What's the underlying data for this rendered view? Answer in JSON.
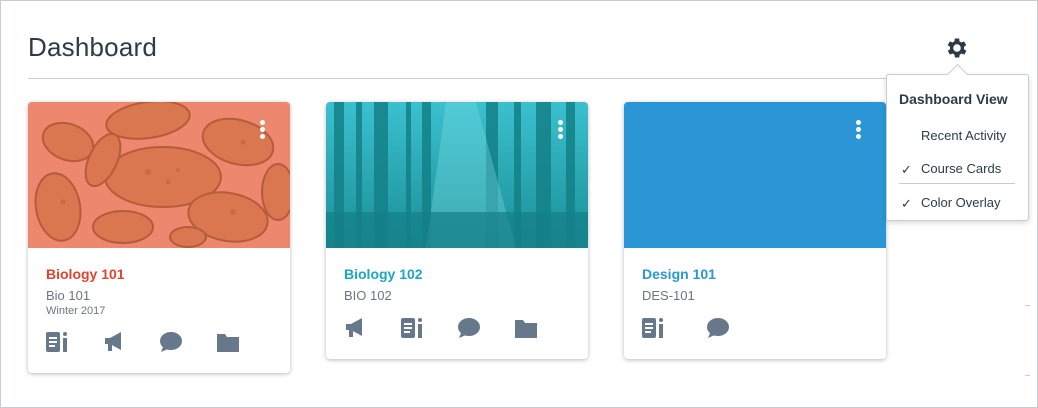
{
  "page": {
    "title": "Dashboard"
  },
  "settings_menu": {
    "heading": "Dashboard View",
    "items": [
      {
        "label": "Recent Activity",
        "checked": false
      },
      {
        "label": "Course Cards",
        "checked": true
      },
      {
        "label": "Color Overlay",
        "checked": true
      }
    ],
    "check_glyph": "✓"
  },
  "cards": [
    {
      "name": "Biology 101",
      "code": "Bio 101",
      "term": "Winter 2017",
      "color": "#e0432d",
      "icons": [
        "assignments-icon",
        "announcements-icon",
        "discussions-icon",
        "files-icon"
      ]
    },
    {
      "name": "Biology 102",
      "code": "BIO 102",
      "term": "",
      "color": "#1ba6c1",
      "icons": [
        "announcements-icon",
        "assignments-icon",
        "discussions-icon",
        "files-icon"
      ]
    },
    {
      "name": "Design 101",
      "code": "DES-101",
      "term": "",
      "color": "#2b96d6",
      "icons": [
        "assignments-icon",
        "discussions-icon"
      ]
    }
  ],
  "colors": {
    "icon_gray": "#66788a",
    "text": "#2d3b45",
    "muted": "#6b7780",
    "border": "#c7cdd1"
  }
}
